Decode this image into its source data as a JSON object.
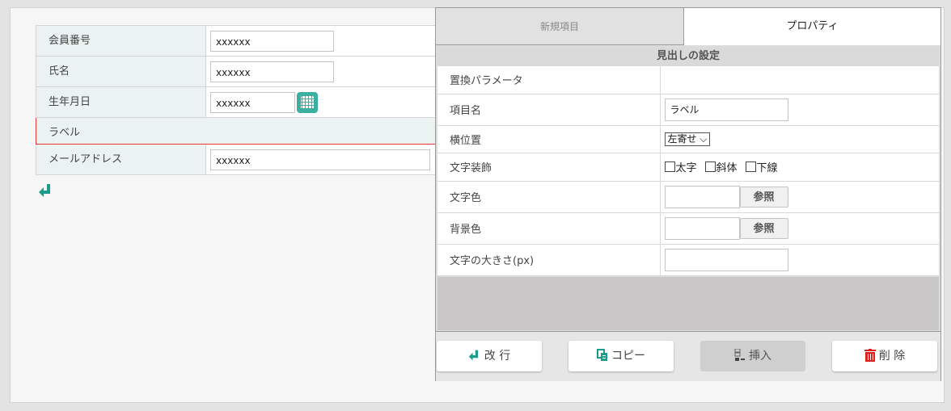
{
  "form": {
    "rows": [
      {
        "label": "会員番号",
        "value": "xxxxxx"
      },
      {
        "label": "氏名",
        "value": "xxxxxx"
      },
      {
        "label": "生年月日",
        "value": "xxxxxx"
      },
      {
        "label": "ラベル"
      },
      {
        "label": "メールアドレス",
        "value": "xxxxxx"
      }
    ]
  },
  "panel": {
    "tabs": {
      "new": "新規項目",
      "properties": "プロパティ"
    },
    "section_title": "見出しの設定",
    "props": {
      "replace_param": {
        "label": "置換パラメータ"
      },
      "item_name": {
        "label": "項目名",
        "value": "ラベル"
      },
      "h_position": {
        "label": "横位置",
        "value": "左寄せ ⌵"
      },
      "text_deco": {
        "label": "文字装飾",
        "bold": "太字",
        "italic": "斜体",
        "underline": "下線"
      },
      "text_color": {
        "label": "文字色",
        "button": "参照"
      },
      "bg_color": {
        "label": "背景色",
        "button": "参照"
      },
      "font_size": {
        "label": "文字の大きさ(px)"
      }
    },
    "footer": {
      "newline": "改 行",
      "copy": "コピー",
      "insert": "挿入",
      "delete": "削 除"
    }
  },
  "colors": {
    "accent": "#1a9c8c",
    "delete": "#e0201e",
    "selected_border": "#e33333"
  }
}
